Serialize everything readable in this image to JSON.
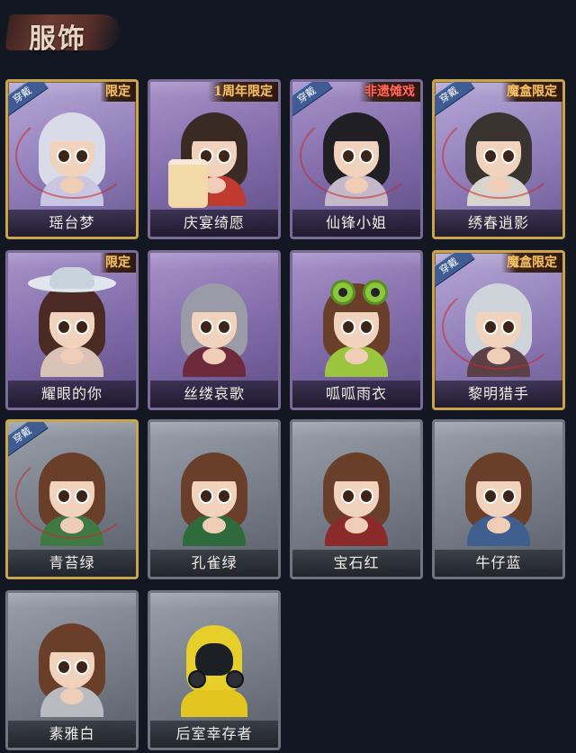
{
  "header": {
    "title": "服饰"
  },
  "costumes": [
    {
      "name": "瑶台梦",
      "tag": "限定",
      "tag_color": "#f2c26a",
      "worn": true,
      "worn_label": "穿戴",
      "rarity": "gold",
      "palette": {
        "hair": "#d9dbe8",
        "body": "#c9c6e3"
      }
    },
    {
      "name": "庆宴绮愿",
      "tag": "1周年限定",
      "tag_color": "#f2c26a",
      "worn": false,
      "worn_label": "",
      "rarity": "purple",
      "palette": {
        "hair": "#3a2a24",
        "body": "#c03a30"
      }
    },
    {
      "name": "仙锋小姐",
      "tag": "非遗傩戏",
      "tag_color": "#ff6a5a",
      "worn": true,
      "worn_label": "穿戴",
      "rarity": "purple",
      "palette": {
        "hair": "#1f1f24",
        "body": "#c5b8c8"
      }
    },
    {
      "name": "绣春逍影",
      "tag": "魔盒限定",
      "tag_color": "#f2c26a",
      "worn": true,
      "worn_label": "穿戴",
      "rarity": "gold",
      "palette": {
        "hair": "#3a3430",
        "body": "#d8d4cf"
      }
    },
    {
      "name": "耀眼的你",
      "tag": "限定",
      "tag_color": "#f2c26a",
      "worn": false,
      "worn_label": "",
      "rarity": "purple",
      "palette": {
        "hair": "#4a2a22",
        "body": "#d9c2b6"
      }
    },
    {
      "name": "丝缕哀歌",
      "tag": "",
      "tag_color": "",
      "worn": false,
      "worn_label": "",
      "rarity": "purple",
      "palette": {
        "hair": "#9a9aa8",
        "body": "#6d2a3a"
      }
    },
    {
      "name": "呱呱雨衣",
      "tag": "",
      "tag_color": "",
      "worn": false,
      "worn_label": "",
      "rarity": "purple",
      "palette": {
        "hair": "#6a3f2a",
        "body": "#9cc53f"
      }
    },
    {
      "name": "黎明猎手",
      "tag": "魔盒限定",
      "tag_color": "#f2c26a",
      "worn": true,
      "worn_label": "穿戴",
      "rarity": "gold",
      "palette": {
        "hair": "#cfd3da",
        "body": "#5b4048"
      }
    },
    {
      "name": "青苔绿",
      "tag": "",
      "tag_color": "",
      "worn": true,
      "worn_label": "穿戴",
      "rarity": "grey",
      "palette": {
        "hair": "#6a3f2a",
        "body": "#3f7a45"
      }
    },
    {
      "name": "孔雀绿",
      "tag": "",
      "tag_color": "",
      "worn": false,
      "worn_label": "",
      "rarity": "grey",
      "palette": {
        "hair": "#6a3f2a",
        "body": "#2f6a3c"
      }
    },
    {
      "name": "宝石红",
      "tag": "",
      "tag_color": "",
      "worn": false,
      "worn_label": "",
      "rarity": "grey",
      "palette": {
        "hair": "#6a3f2a",
        "body": "#8a2a2a"
      }
    },
    {
      "name": "牛仔蓝",
      "tag": "",
      "tag_color": "",
      "worn": false,
      "worn_label": "",
      "rarity": "grey",
      "palette": {
        "hair": "#6a3f2a",
        "body": "#3f5f8f"
      }
    },
    {
      "name": "素雅白",
      "tag": "",
      "tag_color": "",
      "worn": false,
      "worn_label": "",
      "rarity": "grey",
      "palette": {
        "hair": "#6a3f2a",
        "body": "#b8bcc2"
      }
    },
    {
      "name": "后室幸存者",
      "tag": "",
      "tag_color": "",
      "worn": false,
      "worn_label": "",
      "rarity": "grey",
      "palette": {
        "hair": "#e2c51f",
        "body": "#e2c51f"
      }
    }
  ]
}
